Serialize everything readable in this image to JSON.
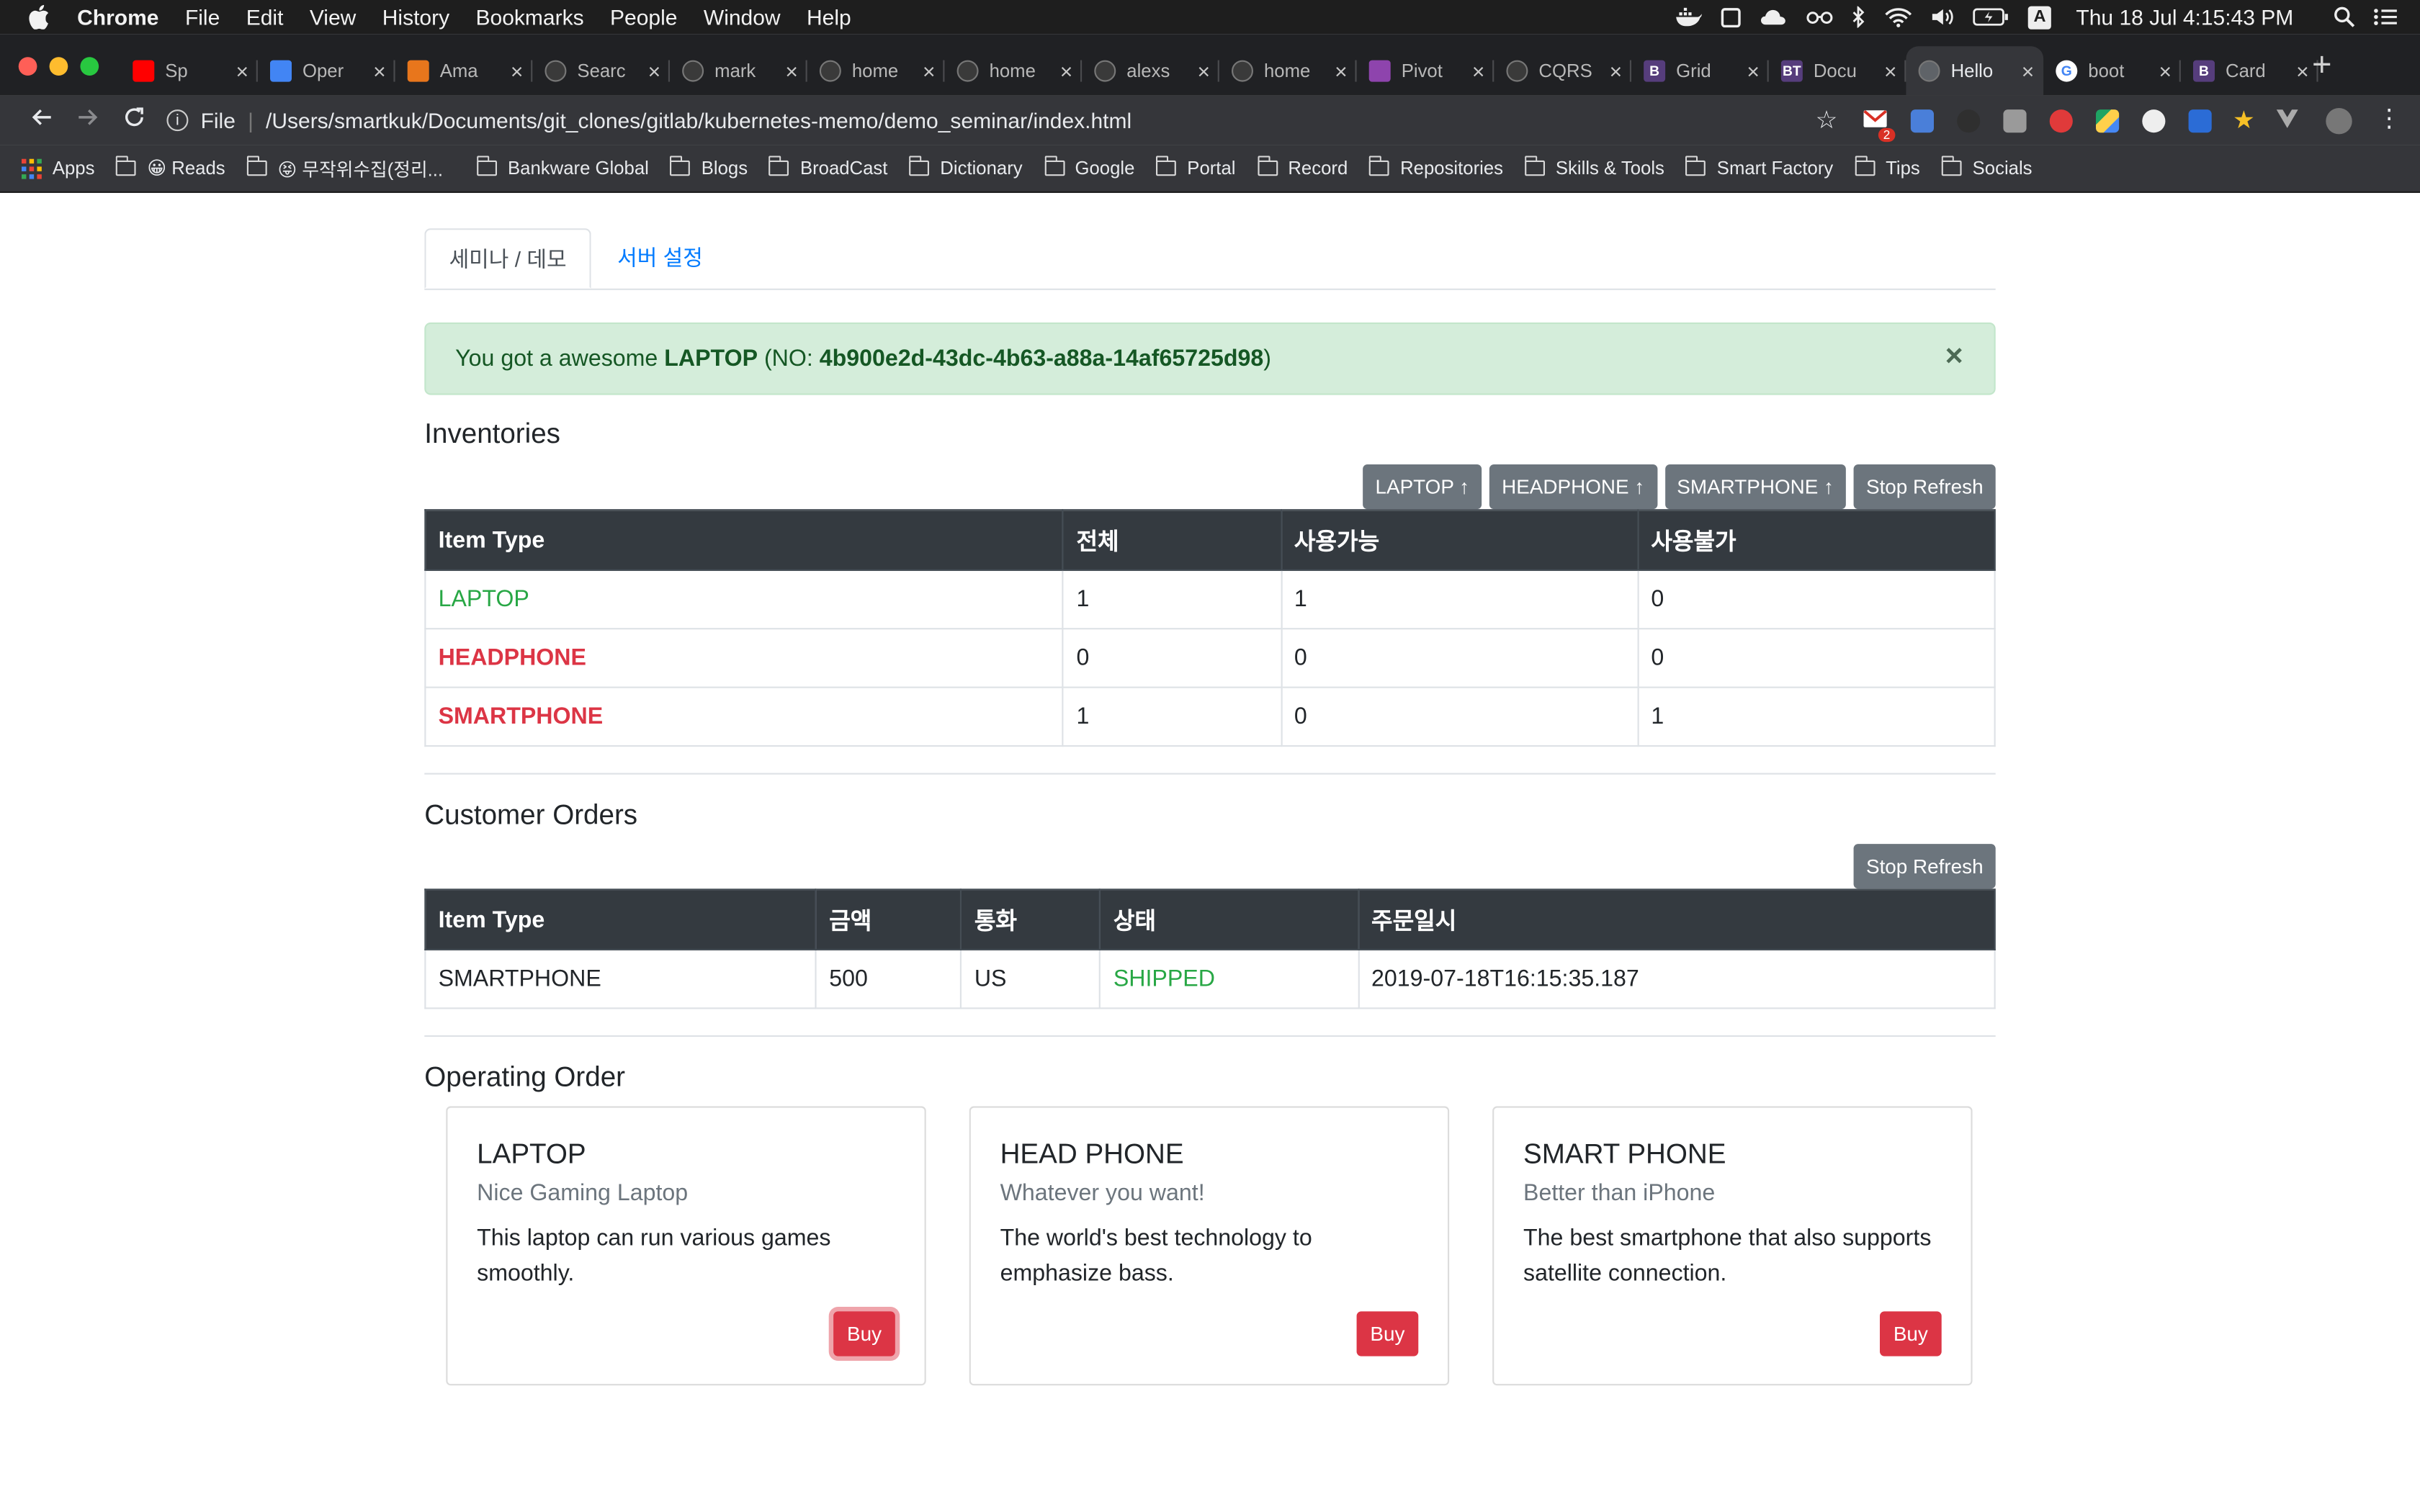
{
  "menubar": {
    "app": "Chrome",
    "items": [
      "File",
      "Edit",
      "View",
      "History",
      "Bookmarks",
      "People",
      "Window",
      "Help"
    ],
    "clock": "Thu 18 Jul  4:15:43 PM",
    "input_source": "A"
  },
  "tabs": [
    {
      "title": "Sp",
      "icon": "youtube-icon",
      "color": "#ff0000"
    },
    {
      "title": "Oper",
      "icon": "docs-icon",
      "color": "#4285f4"
    },
    {
      "title": "Ama",
      "icon": "aws-icon",
      "color": "#e8761c"
    },
    {
      "title": "Searc",
      "icon": "github-icon",
      "color": "#3a3a3a"
    },
    {
      "title": "mark",
      "icon": "github-icon",
      "color": "#3a3a3a"
    },
    {
      "title": "home",
      "icon": "github-icon",
      "color": "#3a3a3a"
    },
    {
      "title": "home",
      "icon": "github-icon",
      "color": "#3a3a3a"
    },
    {
      "title": "alexs",
      "icon": "github-icon",
      "color": "#3a3a3a"
    },
    {
      "title": "home",
      "icon": "github-icon",
      "color": "#3a3a3a"
    },
    {
      "title": "Pivot",
      "icon": "pivotal-icon",
      "color": "#8e44ad"
    },
    {
      "title": "CQRS",
      "icon": "github-icon",
      "color": "#3a3a3a"
    },
    {
      "title": "Grid",
      "icon": "bootstrap-icon",
      "color": "#563d7c",
      "glyph": "B"
    },
    {
      "title": "Docu",
      "icon": "bootstrap-themes-icon",
      "color": "#563d7c",
      "glyph": "BT"
    },
    {
      "title": "Hello",
      "icon": "globe-icon",
      "color": "#5f6368",
      "active": true
    },
    {
      "title": "boot",
      "icon": "google-icon",
      "color": "#ffffff",
      "glyph": "G"
    },
    {
      "title": "Card",
      "icon": "bootstrap-icon",
      "color": "#563d7c",
      "glyph": "B"
    }
  ],
  "toolbar": {
    "scheme_label": "File",
    "url": "/Users/smartkuk/Documents/git_clones/gitlab/kubernetes-memo/demo_seminar/index.html",
    "gmail_badge": "2"
  },
  "bookmarks": [
    {
      "label": "Apps",
      "kind": "apps"
    },
    {
      "label": "😀 Reads",
      "kind": "folder"
    },
    {
      "label": "😝 무작위수집(정리...",
      "kind": "folder"
    },
    {
      "label": "Bankware Global",
      "kind": "folder"
    },
    {
      "label": "Blogs",
      "kind": "folder"
    },
    {
      "label": "BroadCast",
      "kind": "folder"
    },
    {
      "label": "Dictionary",
      "kind": "folder"
    },
    {
      "label": "Google",
      "kind": "folder"
    },
    {
      "label": "Portal",
      "kind": "folder"
    },
    {
      "label": "Record",
      "kind": "folder"
    },
    {
      "label": "Repositories",
      "kind": "folder"
    },
    {
      "label": "Skills & Tools",
      "kind": "folder"
    },
    {
      "label": "Smart Factory",
      "kind": "folder"
    },
    {
      "label": "Tips",
      "kind": "folder"
    },
    {
      "label": "Socials",
      "kind": "folder"
    }
  ],
  "page": {
    "tabs": {
      "active": "세미나 / 데모",
      "other": "서버 설정"
    },
    "alert": {
      "prefix": "You got a awesome ",
      "item": "LAPTOP",
      "mid": " (NO: ",
      "number": "4b900e2d-43dc-4b63-a88a-14af65725d98",
      "suffix": ")",
      "close": "×"
    },
    "inventories": {
      "title": "Inventories",
      "buttons": [
        "LAPTOP ↑",
        "HEADPHONE ↑",
        "SMARTPHONE ↑",
        "Stop Refresh"
      ],
      "headers": [
        "Item Type",
        "전체",
        "사용가능",
        "사용불가"
      ],
      "rows": [
        {
          "type": "LAPTOP",
          "total": "1",
          "available": "1",
          "unavailable": "0",
          "status": "available"
        },
        {
          "type": "HEADPHONE",
          "total": "0",
          "available": "0",
          "unavailable": "0",
          "status": "unavailable"
        },
        {
          "type": "SMARTPHONE",
          "total": "1",
          "available": "0",
          "unavailable": "1",
          "status": "unavailable"
        }
      ]
    },
    "orders": {
      "title": "Customer Orders",
      "button": "Stop Refresh",
      "headers": [
        "Item Type",
        "금액",
        "통화",
        "상태",
        "주문일시"
      ],
      "rows": [
        {
          "type": "SMARTPHONE",
          "amount": "500",
          "currency": "US",
          "status": "SHIPPED",
          "ordered_at": "2019-07-18T16:15:35.187"
        }
      ]
    },
    "operating": {
      "title": "Operating Order",
      "cards": [
        {
          "title": "LAPTOP",
          "subtitle": "Nice Gaming Laptop",
          "text": "This laptop can run various games smoothly.",
          "button": "Buy"
        },
        {
          "title": "HEAD PHONE",
          "subtitle": "Whatever you want!",
          "text": "The world's best technology to emphasize bass.",
          "button": "Buy"
        },
        {
          "title": "SMART PHONE",
          "subtitle": "Better than iPhone",
          "text": "The best smartphone that also supports satellite connection.",
          "button": "Buy"
        }
      ]
    }
  },
  "colors": {
    "success": "#28a745",
    "danger": "#dc3545",
    "secondary": "#6c757d",
    "dark": "#343a40",
    "link": "#007bff"
  }
}
